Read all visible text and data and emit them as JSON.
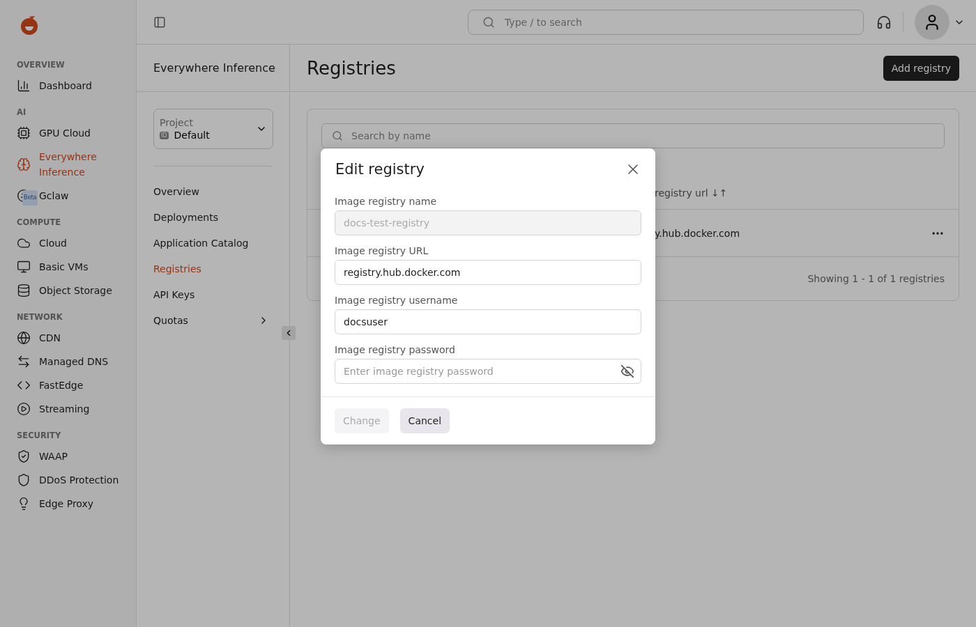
{
  "sidebar": {
    "sections": [
      {
        "title": "OVERVIEW",
        "items": [
          {
            "label": "Dashboard",
            "selected": false
          }
        ]
      },
      {
        "title": "AI",
        "items": [
          {
            "label": "GPU Cloud",
            "selected": false
          },
          {
            "label": "Everywhere Inference",
            "selected": true
          },
          {
            "label": "Gclaw",
            "selected": false,
            "badge": "Beta"
          }
        ]
      },
      {
        "title": "COMPUTE",
        "items": [
          {
            "label": "Cloud",
            "selected": false
          },
          {
            "label": "Basic VMs",
            "selected": false
          },
          {
            "label": "Object Storage",
            "selected": false
          }
        ]
      },
      {
        "title": "NETWORK",
        "items": [
          {
            "label": "CDN",
            "selected": false
          },
          {
            "label": "Managed DNS",
            "selected": false
          },
          {
            "label": "FastEdge",
            "selected": false
          },
          {
            "label": "Streaming",
            "selected": false
          }
        ]
      },
      {
        "title": "SECURITY",
        "items": [
          {
            "label": "WAAP",
            "selected": false
          },
          {
            "label": "DDoS Protection",
            "selected": false
          },
          {
            "label": "Edge Proxy",
            "selected": false
          }
        ]
      }
    ]
  },
  "topbar": {
    "search": {
      "placeholder": "Type / to search"
    }
  },
  "subnav": {
    "title": "Everywhere Inference",
    "project": {
      "label": "Project",
      "badge": "ID",
      "value": "Default"
    },
    "items": [
      {
        "label": "Overview",
        "selected": false,
        "has_children": false
      },
      {
        "label": "Deployments",
        "selected": false,
        "has_children": false
      },
      {
        "label": "Application Catalog",
        "selected": false,
        "has_children": false
      },
      {
        "label": "Registries",
        "selected": true,
        "has_children": false
      },
      {
        "label": "API Keys",
        "selected": false,
        "has_children": false
      },
      {
        "label": "Quotas",
        "selected": false,
        "has_children": true
      }
    ]
  },
  "page": {
    "title": "Registries",
    "add_button": "Add registry"
  },
  "table": {
    "search": {
      "placeholder": "Search by name"
    },
    "column_2": "registry url ↓↑",
    "rows": [
      {
        "column_2": "y.hub.docker.com"
      }
    ],
    "footer": "Showing 1 - 1 of 1 registries"
  },
  "dialog": {
    "title": "Edit registry",
    "fields": [
      {
        "label": "Image registry name",
        "value": "docs-test-registry",
        "disabled": true
      },
      {
        "label": "Image registry URL",
        "value": "registry.hub.docker.com",
        "disabled": false
      },
      {
        "label": "Image registry username",
        "value": "docsuser",
        "disabled": false
      },
      {
        "label": "Image registry password",
        "placeholder": "Enter image registry password",
        "disabled": false,
        "secret": true
      }
    ],
    "buttons": [
      {
        "label": "Change",
        "disabled": true
      },
      {
        "label": "Cancel",
        "disabled": false
      }
    ]
  }
}
